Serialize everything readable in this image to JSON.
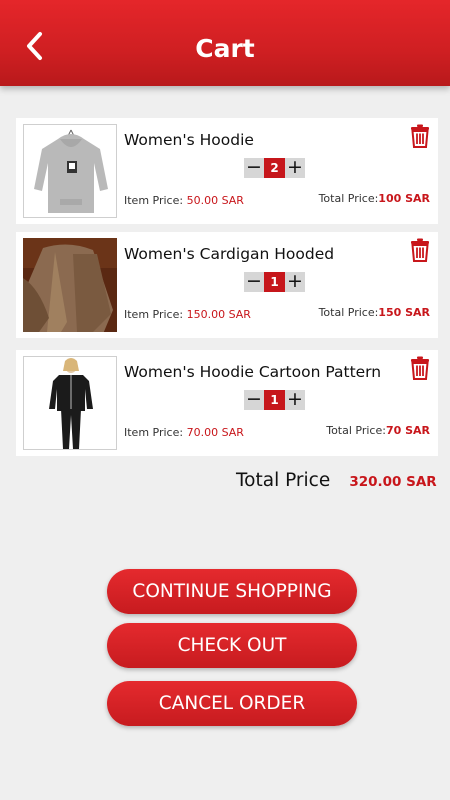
{
  "header": {
    "title": "Cart",
    "back_icon": "chevron-left-icon"
  },
  "items": [
    {
      "name": "Women's Hoodie",
      "qty": "2",
      "item_price_label": "Item Price: ",
      "item_price": "50.00 SAR",
      "total_price_label": "Total Price:",
      "total_price": "100 SAR"
    },
    {
      "name": "Women's Cardigan Hooded",
      "qty": "1",
      "item_price_label": "Item Price: ",
      "item_price": "150.00 SAR",
      "total_price_label": "Total Price:",
      "total_price": "150 SAR"
    },
    {
      "name": "Women's Hoodie Cartoon Pattern",
      "qty": "1",
      "item_price_label": "Item Price: ",
      "item_price": "70.00 SAR",
      "total_price_label": "Total Price:",
      "total_price": "70 SAR"
    }
  ],
  "stepper": {
    "minus": "−",
    "plus": "+"
  },
  "summary": {
    "label": "Total Price",
    "value": "320.00 SAR"
  },
  "buttons": {
    "continue": "CONTINUE SHOPPING",
    "checkout": "CHECK OUT",
    "cancel": "CANCEL ORDER"
  },
  "colors": {
    "accent": "#d0202a",
    "qty_bg": "#c6161b",
    "stepper_bg": "#d6d6d6",
    "page_bg": "#efefef"
  }
}
